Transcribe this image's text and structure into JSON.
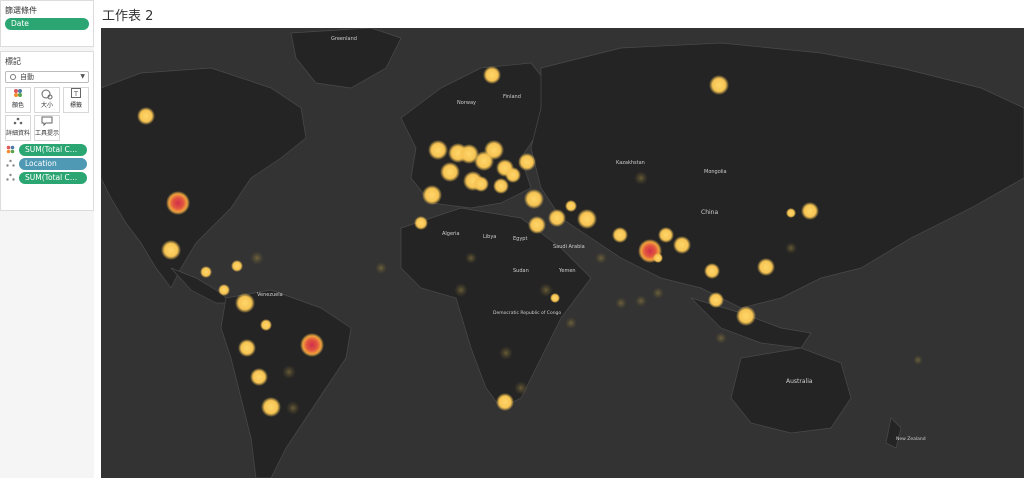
{
  "filters": {
    "title": "篩選條件",
    "pill": "Date"
  },
  "marks": {
    "title": "標記",
    "mark_type": "自動",
    "buttons": [
      {
        "label": "顏色",
        "icon": "color-icon"
      },
      {
        "label": "大小",
        "icon": "size-icon"
      },
      {
        "label": "標籤",
        "icon": "label-icon"
      },
      {
        "label": "詳細資料",
        "icon": "detail-icon"
      },
      {
        "label": "工具提示",
        "icon": "tooltip-icon"
      }
    ],
    "shelf": [
      {
        "label": "SUM(Total Cas..",
        "color": "green",
        "icon": "color-icon"
      },
      {
        "label": "Location",
        "color": "blue",
        "icon": "detail-icon"
      },
      {
        "label": "SUM(Total Cas..",
        "color": "green",
        "icon": "detail-icon"
      }
    ]
  },
  "sheet": {
    "title": "工作表 2"
  },
  "map": {
    "background": "#333333",
    "land_color": "#242424",
    "labels": [
      "Greenland",
      "Norway",
      "Finland",
      "Kazakhstan",
      "Mongolia",
      "China",
      "Algeria",
      "Libya",
      "Egypt",
      "Saudi Arabia",
      "Sudan",
      "Yemen",
      "Venezuela",
      "Democratic Republic of Congo",
      "Australia",
      "New Zealand"
    ],
    "color_scale": {
      "low": "#f5c04f",
      "mid": "#f0a03a",
      "high": "#d9354a"
    }
  }
}
